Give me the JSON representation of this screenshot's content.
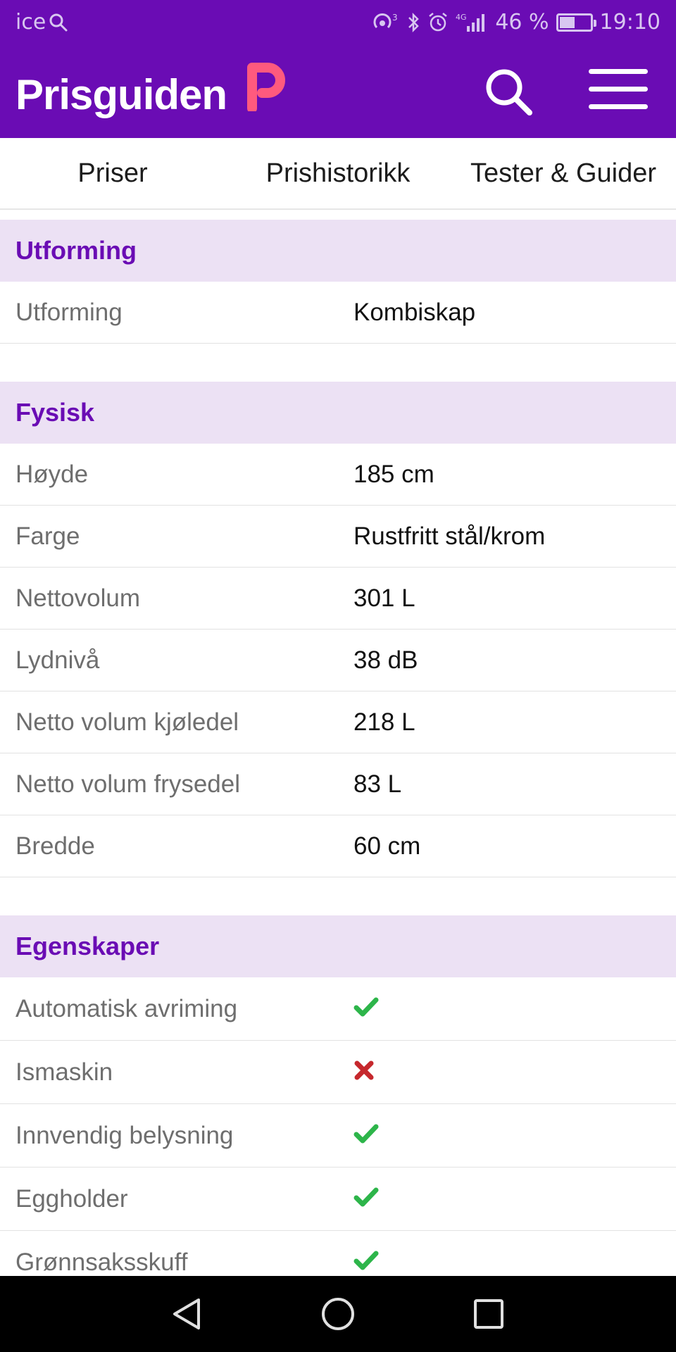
{
  "status_bar": {
    "carrier": "ice",
    "network": "4G",
    "battery_percent": "46 %",
    "battery_level": 0.46,
    "time": "19:10"
  },
  "header": {
    "logo_text": "Prisguiden",
    "logo_mark": "P",
    "brand_color": "#6a0cb4",
    "accent_color": "#ff5a7e",
    "search_icon": "search-icon",
    "menu_icon": "hamburger-menu-icon"
  },
  "tabs": [
    {
      "label": "Priser"
    },
    {
      "label": "Prishistorikk"
    },
    {
      "label": "Tester & Guider"
    }
  ],
  "sections": {
    "utforming": {
      "title": "Utforming",
      "rows": [
        {
          "label": "Utforming",
          "value": "Kombiskap"
        }
      ]
    },
    "fysisk": {
      "title": "Fysisk",
      "rows": [
        {
          "label": "Høyde",
          "value": "185 cm"
        },
        {
          "label": "Farge",
          "value": "Rustfritt stål/krom"
        },
        {
          "label": "Nettovolum",
          "value": "301 L"
        },
        {
          "label": "Lydnivå",
          "value": "38 dB"
        },
        {
          "label": "Netto volum kjøledel",
          "value": "218 L"
        },
        {
          "label": "Netto volum frysedel",
          "value": "83 L"
        },
        {
          "label": "Bredde",
          "value": "60 cm"
        }
      ]
    },
    "egenskaper": {
      "title": "Egenskaper",
      "rows": [
        {
          "label": "Automatisk avriming",
          "value": "check"
        },
        {
          "label": "Ismaskin",
          "value": "cross"
        },
        {
          "label": "Innvendig belysning",
          "value": "check"
        },
        {
          "label": "Eggholder",
          "value": "check"
        },
        {
          "label": "Grønnsaksskuff",
          "value": "check"
        }
      ]
    }
  },
  "colors": {
    "check": "#2db54a",
    "cross": "#c6282d",
    "section_bg": "#ece1f4"
  },
  "nav_bar": {
    "back_icon": "back-triangle-icon",
    "home_icon": "home-circle-icon",
    "recents_icon": "recents-square-icon"
  }
}
